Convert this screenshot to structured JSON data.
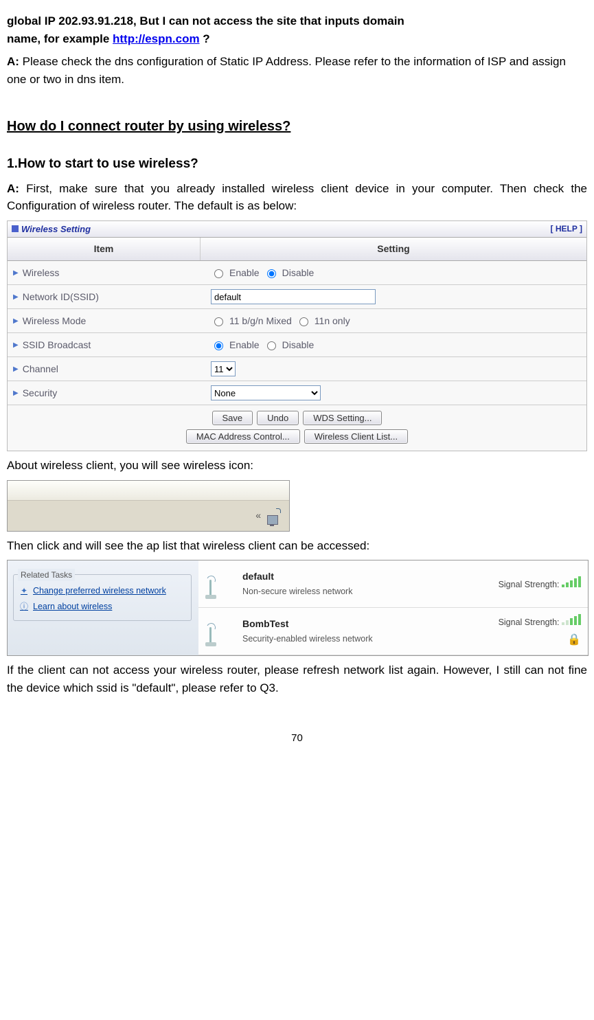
{
  "q_prev": {
    "line1_a": "global IP 202.93.91.218, But I can not access the site that inputs domain",
    "line2_a": "name, for example ",
    "link": "http://espn.com",
    "line2_b": " ?"
  },
  "ans_prev": {
    "prefix": "A:",
    "text": " Please check the dns configuration of Static IP Address. Please refer to the information of ISP and assign one or two in dns item."
  },
  "sec_title": "How do I connect router by using wireless?",
  "q1": "1.How to start to use wireless?",
  "ans1": {
    "prefix": "A:",
    "text": " First, make sure that you already installed wireless client device in your computer. Then check the Configuration of wireless router. The default is as below:"
  },
  "panel": {
    "title": "Wireless Setting",
    "help": "[ HELP ]",
    "header_item": "Item",
    "header_setting": "Setting",
    "rows": {
      "wireless": "Wireless",
      "ssid": "Network ID(SSID)",
      "mode": "Wireless Mode",
      "broadcast": "SSID Broadcast",
      "channel": "Channel",
      "security": "Security"
    },
    "radio": {
      "enable": "Enable",
      "disable": "Disable",
      "mode_mixed": "11 b/g/n Mixed",
      "mode_11n": "11n only"
    },
    "ssid_value": "default",
    "channel_value": "11",
    "security_value": "None",
    "buttons": {
      "save": "Save",
      "undo": "Undo",
      "wds": "WDS Setting...",
      "mac": "MAC Address Control...",
      "clients": "Wireless Client List..."
    }
  },
  "text_after_panel": "About wireless client, you will see wireless icon:",
  "tray": {
    "chevrons": "«"
  },
  "text_after_tray": "Then click and will see the ap list that wireless client can be accessed:",
  "aplist": {
    "sidebar": {
      "legend": "Related Tasks",
      "link1": "Change preferred wireless network",
      "link2": "Learn about wireless"
    },
    "entries": [
      {
        "name": "default",
        "desc": "Non-secure wireless network",
        "sig_label": "Signal Strength:",
        "secure": false,
        "bars": 5
      },
      {
        "name": "BombTest",
        "desc": "Security-enabled wireless network",
        "sig_label": "Signal Strength:",
        "secure": true,
        "bars": 3
      }
    ]
  },
  "text_after_aplist": "If the client can not access your wireless router, please refresh network list again. However, I still can not fine the device which ssid is \"default\", please refer to Q3.",
  "page_number": "70"
}
